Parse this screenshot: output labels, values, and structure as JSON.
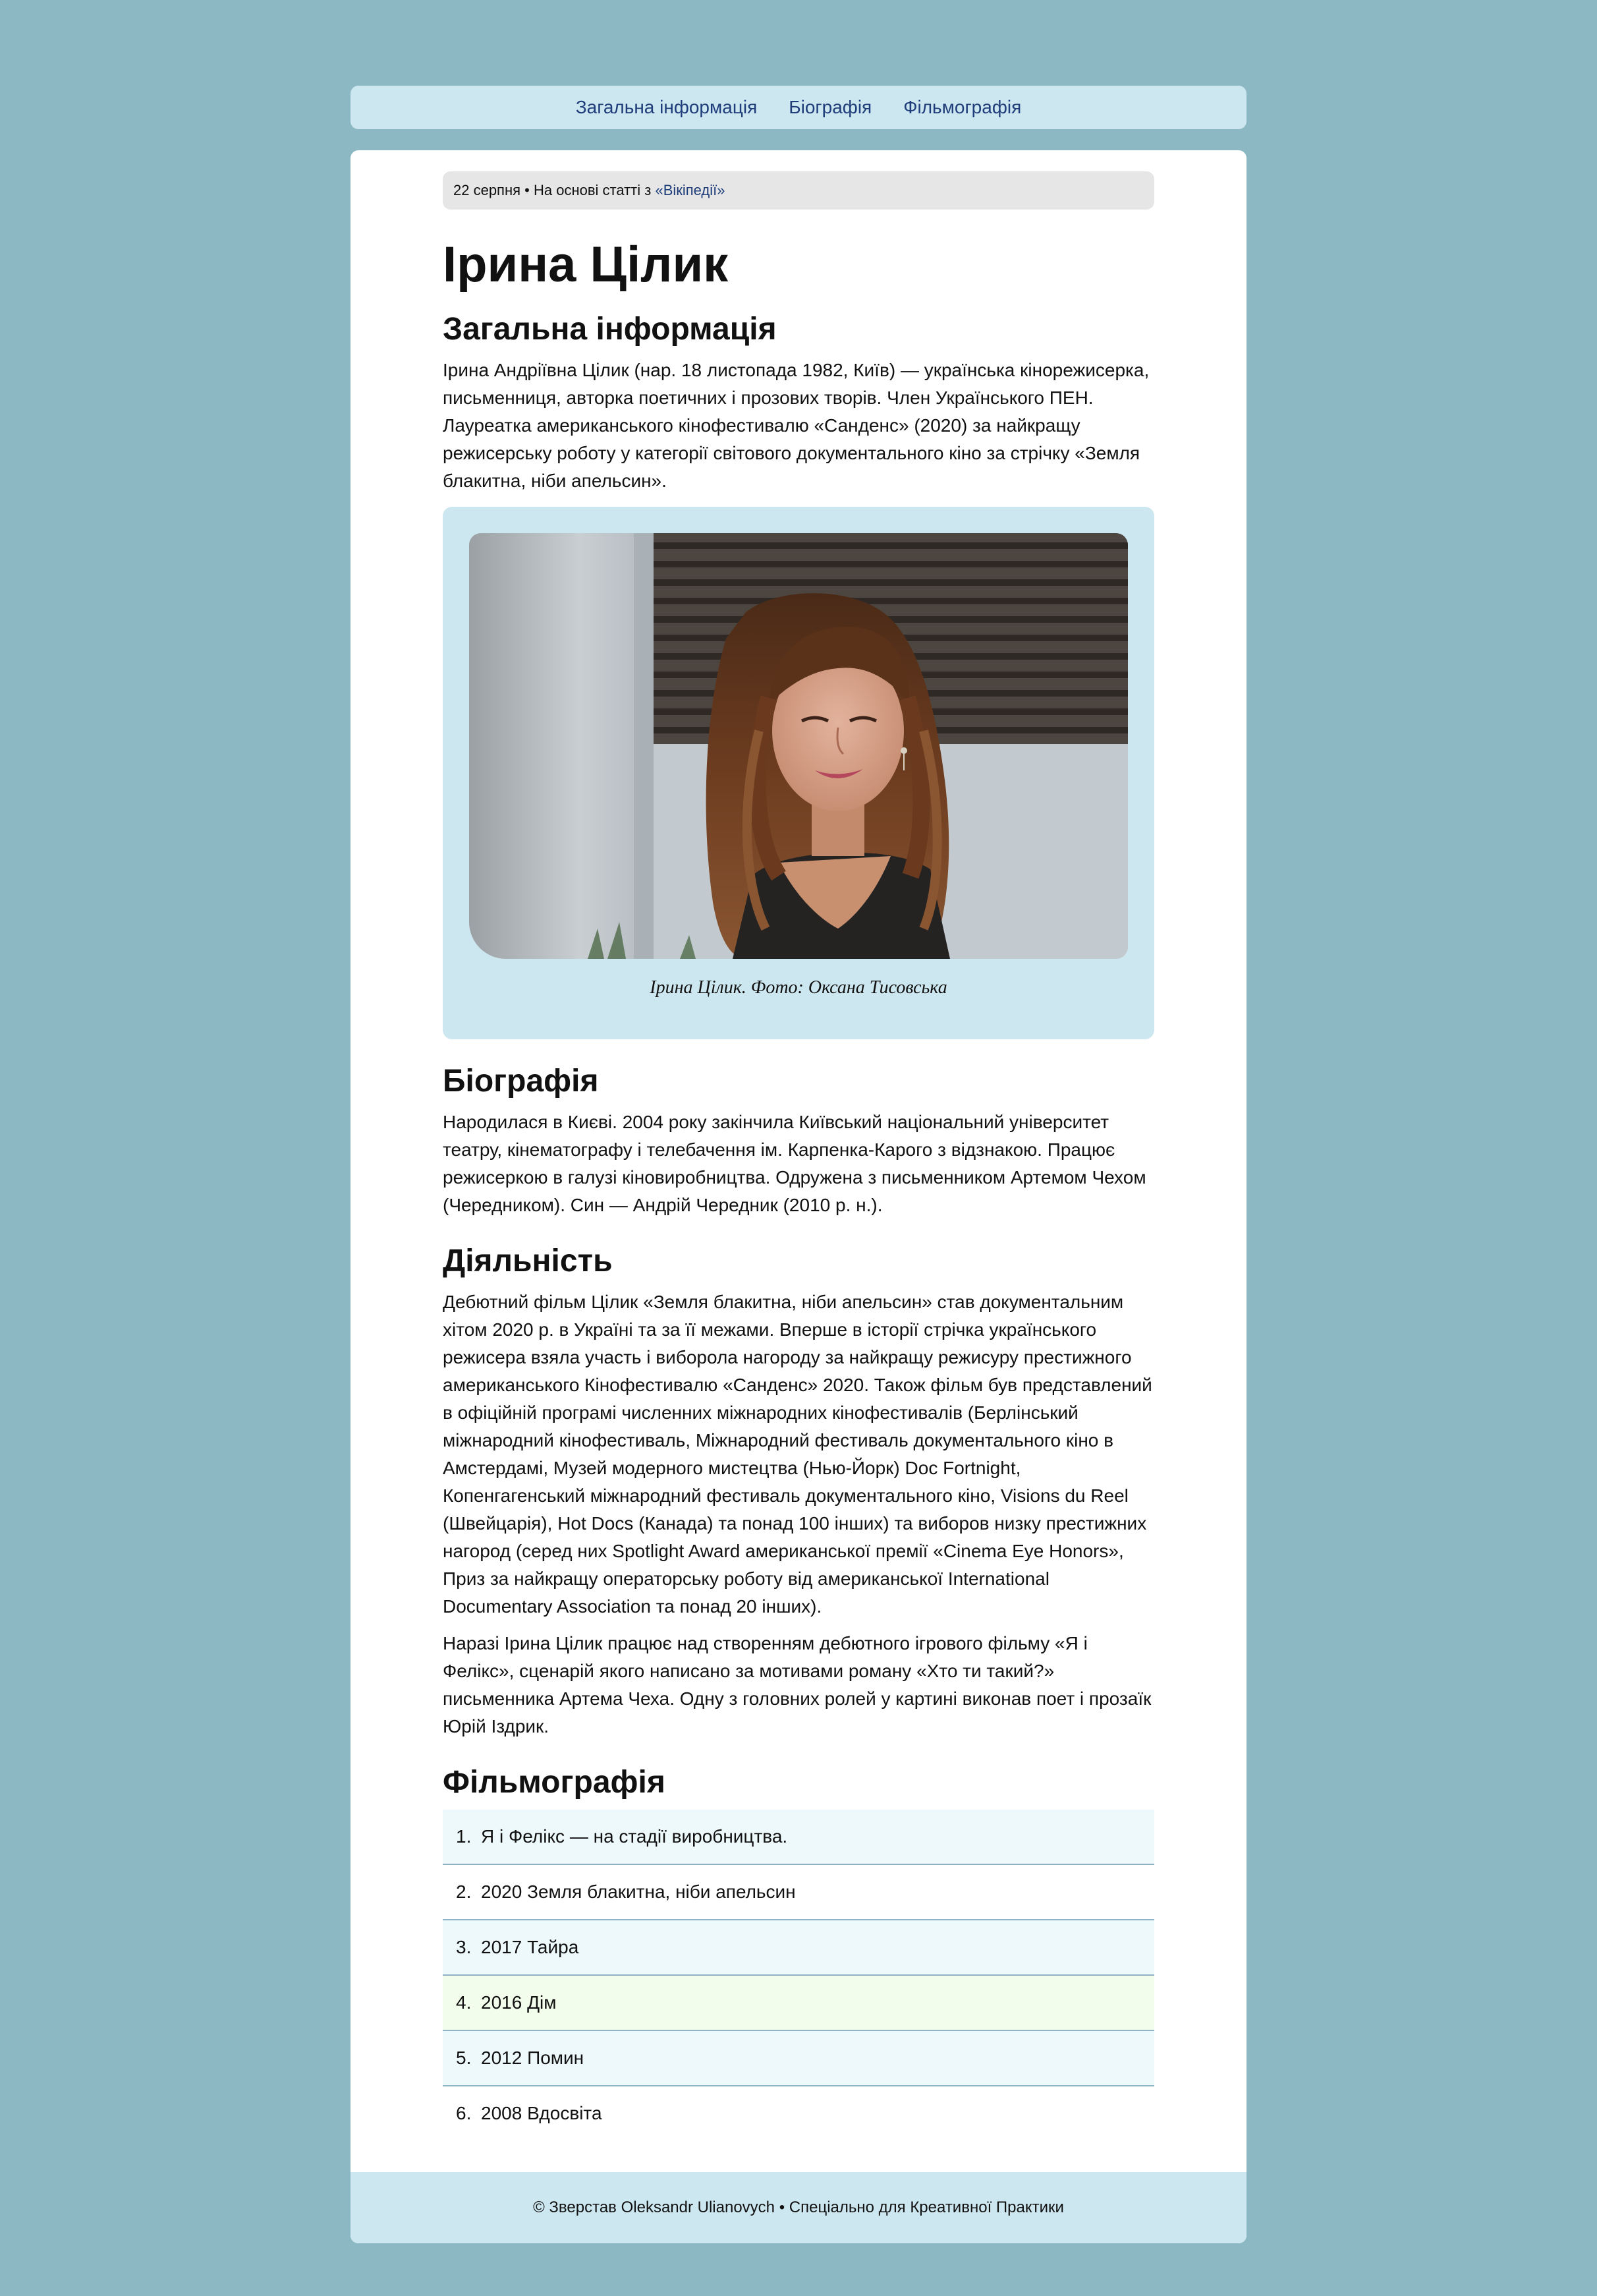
{
  "nav": {
    "items": [
      "Загальна інформація",
      "Біографія",
      "Фільмографія"
    ]
  },
  "meta": {
    "date": "22 серпня",
    "separator": " • ",
    "source_prefix": "На основі статті з ",
    "source_link": "«Вікіпедії»"
  },
  "page": {
    "title": "Ірина Цілик"
  },
  "general": {
    "heading": "Загальна інформація",
    "text": "Ірина Андріївна Цілик (нар. 18 листопада 1982, Київ) — українська кінорежисерка, письменниця, авторка поетичних і прозових творів. Член Українського ПЕН. Лауреатка американського кінофестивалю «Санденс» (2020) за найкращу режисерську роботу у категорії світового документального кіно за стрічку «Земля блакитна, ніби апельсин»."
  },
  "figure": {
    "caption": "Ірина Цілик. Фото: Оксана Тисовська"
  },
  "biography": {
    "heading": "Біографія",
    "text": "Народилася в Києві. 2004 року закінчила Київський національний університет театру, кінематографу і телебачення ім. Карпенка-Карого з відзнакою. Працює режисеркою в галузі кіновиробництва. Одружена з письменником Артемом Чехом (Чередником). Син — Андрій Чередник (2010 р. н.)."
  },
  "activity": {
    "heading": "Діяльність",
    "paragraphs": [
      "Дебютний фільм Цілик «Земля блакитна, ніби апельсин» став документальним хітом 2020 р. в Україні та за її межами. Вперше в історії стрічка українського режисера взяла участь і виборола нагороду за найкращу режисуру престижного американського Кінофестивалю «Санденс» 2020. Також фільм був представлений в офіційній програмі численних міжнародних кінофестивалів (Берлінський міжнародний кінофестиваль, Міжнародний фестиваль документального кіно в Амстердамі, Музей модерного мистецтва (Нью-Йорк) Doc Fortnight, Копенгагенський міжнародний фестиваль документального кіно, Visions du Reel (Швейцарія), Hot Docs (Канада) та понад 100 інших) та виборов низку престижних нагород (серед них Spotlight Award американської премії «Cinema Eye Honors», Приз за найкращу операторську роботу від американської International Documentary Association та понад 20 інших).",
      "Наразі Ірина Цілик працює над створенням дебютного ігрового фільму «Я і Фелікс», сценарій якого написано за мотивами роману «Хто ти такий?» письменника Артема Чеха. Одну з головних ролей у картині виконав поет і прозаїк Юрій Іздрик."
    ]
  },
  "filmography": {
    "heading": "Фільмографія",
    "items": [
      {
        "num": "1.",
        "text": "Я і Фелікс — на стадії виробництва."
      },
      {
        "num": "2.",
        "text": "2020 Земля блакитна, ніби апельсин"
      },
      {
        "num": "3.",
        "text": "2017 Тайра"
      },
      {
        "num": "4.",
        "text": "2016 Дім"
      },
      {
        "num": "5.",
        "text": "2012 Помин"
      },
      {
        "num": "6.",
        "text": "2008 Вдосвіта"
      }
    ]
  },
  "footer": {
    "text": "© Зверстав Oleksandr Ulianovych • Спеціально для Креативної Практики"
  }
}
